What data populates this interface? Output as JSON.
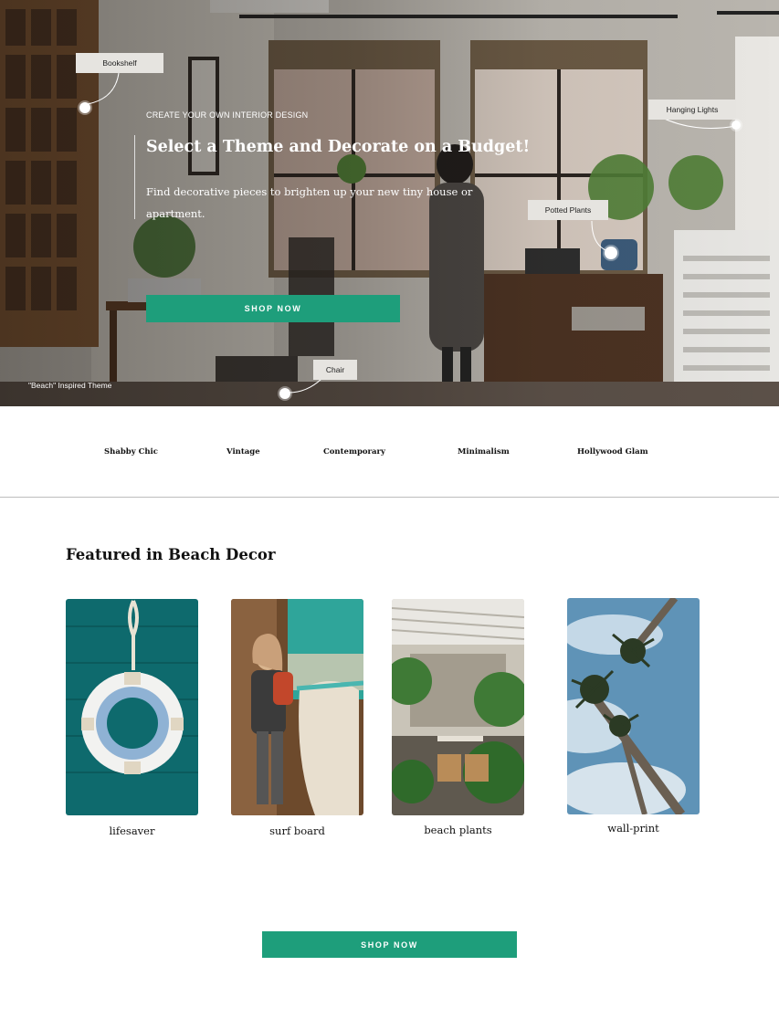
{
  "hero": {
    "eyebrow": "CREATE YOUR OWN INTERIOR DESIGN",
    "title": "Select a Theme and Decorate on a Budget!",
    "subtitle": "Find decorative pieces to brighten up your new tiny house or apartment.",
    "cta_label": "SHOP NOW",
    "caption": "\"Beach\" Inspired Theme",
    "hotspots": {
      "bookshelf": "Bookshelf",
      "hanging_lights": "Hanging Lights",
      "potted_plants": "Potted Plants",
      "chair": "Chair"
    }
  },
  "themes": [
    "Shabby Chic",
    "Vintage",
    "Contemporary",
    "Minimalism",
    "Hollywood Glam"
  ],
  "featured": {
    "title": "Featured in Beach Decor",
    "items": [
      {
        "label": "lifesaver"
      },
      {
        "label": "surf board"
      },
      {
        "label": "beach plants"
      },
      {
        "label": "wall-print"
      }
    ]
  },
  "bottom_cta": {
    "label": "SHOP NOW"
  },
  "colors": {
    "accent": "#1e9e7b",
    "text": "#111111",
    "divider": "#bdbdbd"
  }
}
